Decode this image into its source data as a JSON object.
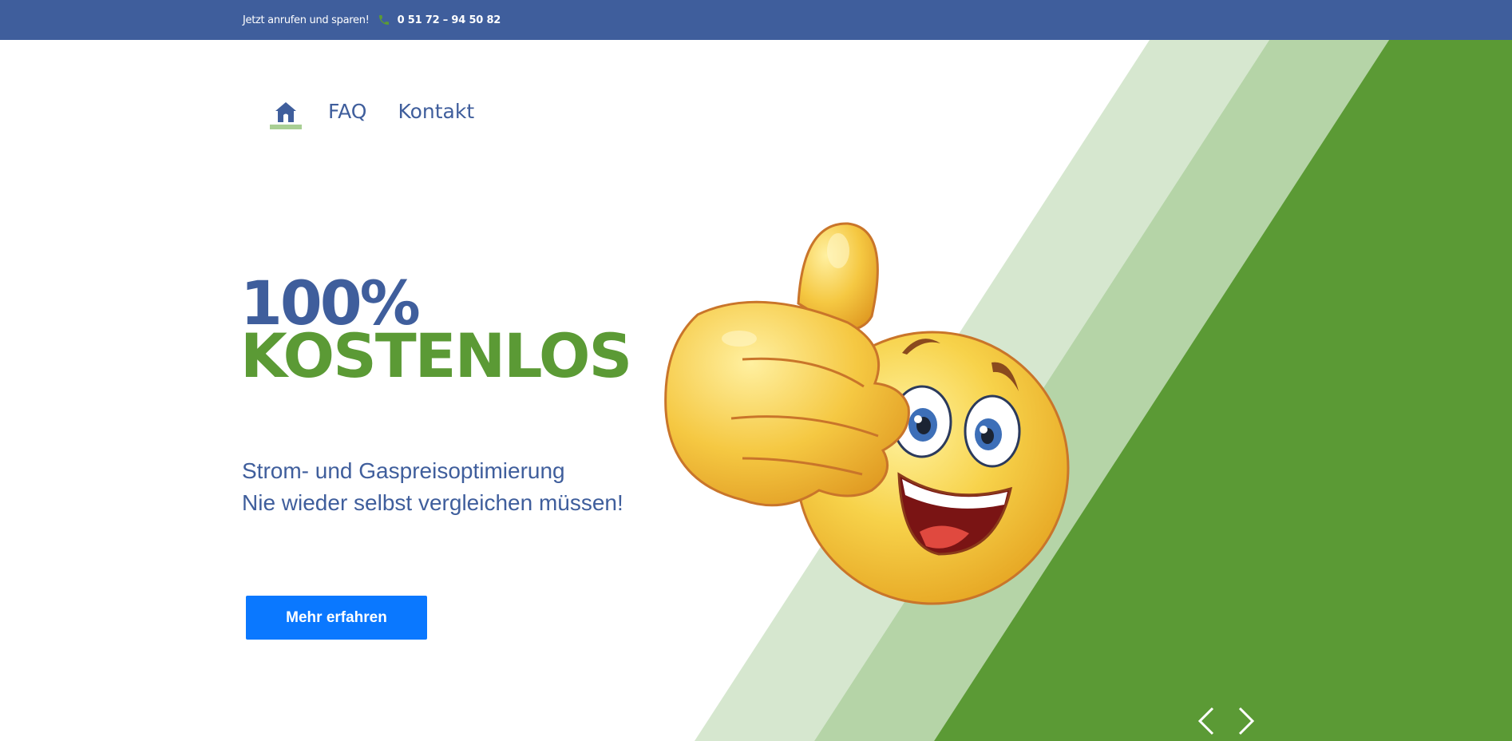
{
  "topbar": {
    "cta_text": "Jetzt anrufen und sparen!",
    "phone_icon": "phone-icon",
    "phone_number": "0 51 72 – 94 50 82"
  },
  "nav": {
    "home_icon": "home-icon",
    "items": [
      {
        "label": "FAQ"
      },
      {
        "label": "Kontakt"
      }
    ]
  },
  "hero": {
    "headline_line1": "100%",
    "headline_line2": "KOSTENLOS",
    "subline_1": "Strom- und Gaspreisoptimierung",
    "subline_2": "Nie wieder selbst vergleichen müssen!",
    "button_label": "Mehr erfahren",
    "image": "thumbs-up-smiley-emoji"
  },
  "slider": {
    "prev_icon": "chevron-left-icon",
    "next_icon": "chevron-right-icon"
  },
  "colors": {
    "topbar_bg": "#3f5e9c",
    "brand_blue": "#3f5e9c",
    "brand_green": "#5b9a35",
    "stripe_light": "#d6e7cf",
    "stripe_mid": "#b5d4a7",
    "button_bg": "#0a78ff",
    "home_underline": "#a9cf94"
  }
}
